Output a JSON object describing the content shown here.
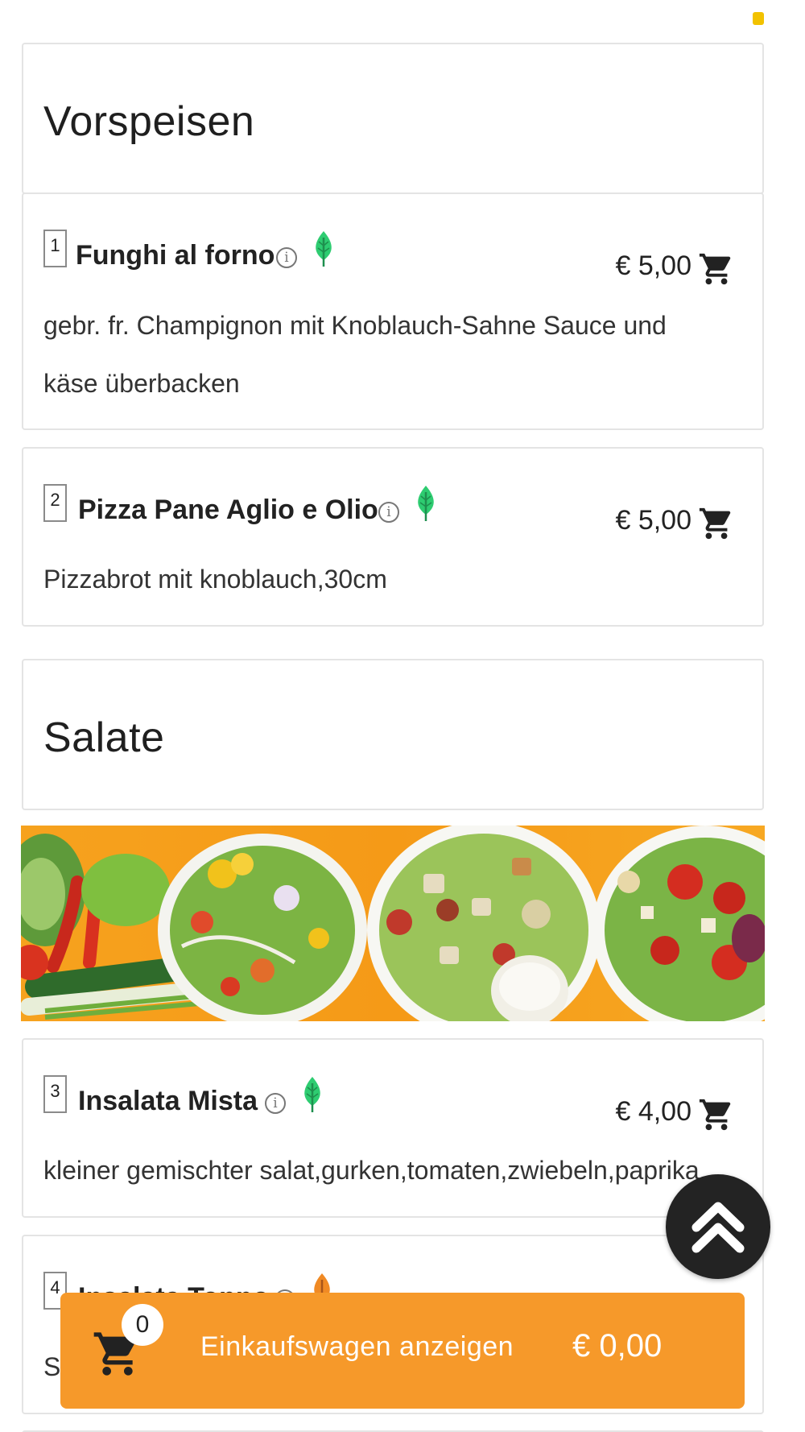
{
  "sections": [
    {
      "title": "Vorspeisen",
      "items": [
        {
          "number": "1",
          "name": "Funghi al forno",
          "price": "€ 5,00",
          "description": [
            "gebr. fr. Champignon mit Knoblauch-Sahne Sauce und",
            "käse überbacken"
          ],
          "diet_icon": "leaf-icon"
        },
        {
          "number": "2",
          "name": "Pizza Pane Aglio e Olio",
          "price": "€ 5,00",
          "description": [
            "Pizzabrot mit knoblauch,30cm"
          ],
          "diet_icon": "leaf-icon"
        }
      ]
    },
    {
      "title": "Salate",
      "items": [
        {
          "number": "3",
          "name": "Insalata Mista",
          "price": "€ 4,00",
          "description": [
            "kleiner gemischter salat,gurken,tomaten,zwiebeln,paprika"
          ],
          "diet_icon": "leaf-icon"
        },
        {
          "number": "4",
          "name": "Insalata Tonno",
          "price": "",
          "description": [
            "S"
          ],
          "diet_icon": "fish-icon"
        }
      ]
    }
  ],
  "info_glyph": "i",
  "cart_bar": {
    "count": "0",
    "label": "Einkaufswagen anzeigen",
    "total": "€ 0,00"
  },
  "colors": {
    "accent": "#f6992a",
    "leaf": "#2ecc71",
    "fish": "#f08a24",
    "dark_button": "#232323"
  }
}
